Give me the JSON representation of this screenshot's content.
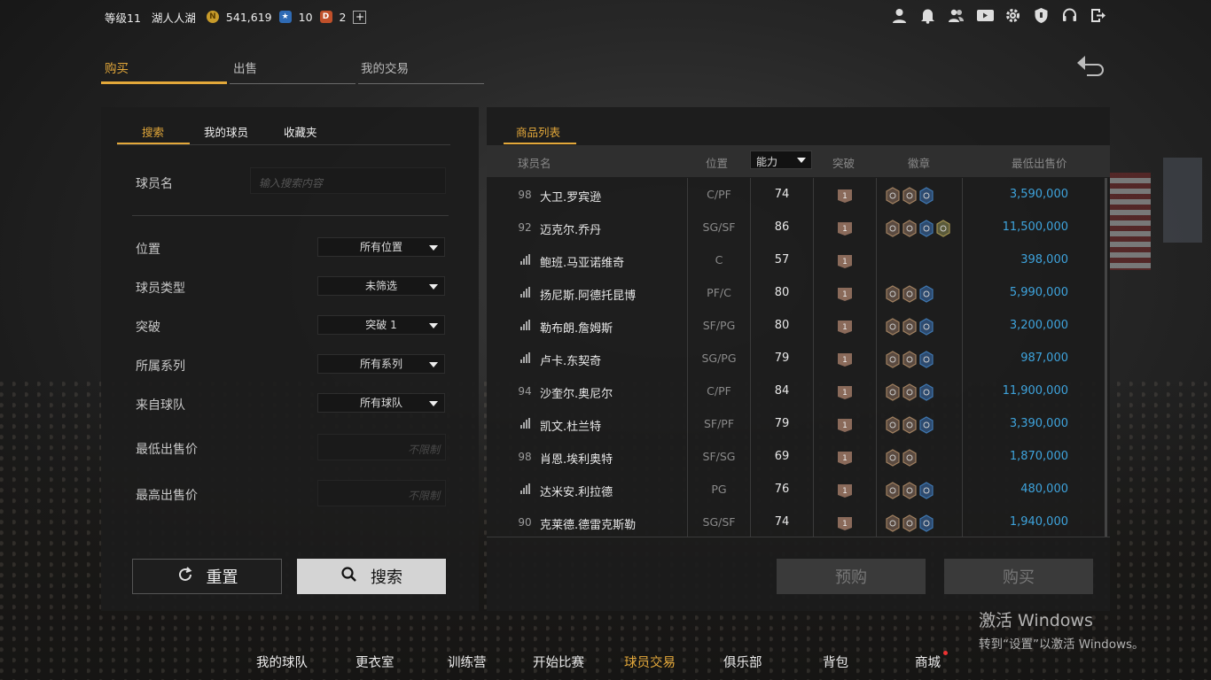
{
  "topbar": {
    "level": "等级11",
    "team_name": "湖人人湖",
    "coins": "541,619",
    "stars": "10",
    "tokens": "2"
  },
  "top_icons": [
    "person-icon",
    "bell-icon",
    "friends-icon",
    "video-icon",
    "gear-icon",
    "shield-icon",
    "headset-icon",
    "logout-icon"
  ],
  "main_tabs": [
    "购买",
    "出售",
    "我的交易"
  ],
  "left_panel": {
    "subtabs": [
      "搜索",
      "我的球员",
      "收藏夹"
    ],
    "player_name_label": "球员名",
    "search_placeholder": "输入搜索内容",
    "filters": [
      {
        "label": "位置",
        "value": "所有位置"
      },
      {
        "label": "球员类型",
        "value": "未筛选"
      },
      {
        "label": "突破",
        "value": "突破 1"
      },
      {
        "label": "所属系列",
        "value": "所有系列"
      },
      {
        "label": "来自球队",
        "value": "所有球队"
      }
    ],
    "min_price_label": "最低出售价",
    "max_price_label": "最高出售价",
    "price_placeholder": "不限制",
    "reset_label": "重置",
    "search_label": "搜索"
  },
  "right_panel": {
    "tab": "商品列表",
    "headers": {
      "name": "球员名",
      "position": "位置",
      "ability": "能力",
      "breakthrough": "突破",
      "badge": "徽章",
      "min_price": "最低出售价"
    },
    "rows": [
      {
        "rank": "98",
        "name": "大卫.罗宾逊",
        "position": "C/PF",
        "ability": "74",
        "badges": 3,
        "price": "3,590,000"
      },
      {
        "rank": "92",
        "name": "迈克尔.乔丹",
        "position": "SG/SF",
        "ability": "86",
        "badges": 4,
        "price": "11,500,000"
      },
      {
        "rank": "",
        "name": "鲍班.马亚诺维奇",
        "position": "C",
        "ability": "57",
        "badges": 0,
        "price": "398,000"
      },
      {
        "rank": "",
        "name": "扬尼斯.阿德托昆博",
        "position": "PF/C",
        "ability": "80",
        "badges": 3,
        "price": "5,990,000"
      },
      {
        "rank": "",
        "name": "勒布朗.詹姆斯",
        "position": "SF/PG",
        "ability": "80",
        "badges": 3,
        "price": "3,200,000"
      },
      {
        "rank": "",
        "name": "卢卡.东契奇",
        "position": "SG/PG",
        "ability": "79",
        "badges": 3,
        "price": "987,000"
      },
      {
        "rank": "94",
        "name": "沙奎尔.奥尼尔",
        "position": "C/PF",
        "ability": "84",
        "badges": 3,
        "price": "11,900,000"
      },
      {
        "rank": "",
        "name": "凯文.杜兰特",
        "position": "SF/PF",
        "ability": "79",
        "badges": 3,
        "price": "3,390,000"
      },
      {
        "rank": "98",
        "name": "肖恩.埃利奥特",
        "position": "SF/SG",
        "ability": "69",
        "badges": 2,
        "price": "1,870,000"
      },
      {
        "rank": "",
        "name": "达米安.利拉德",
        "position": "PG",
        "ability": "76",
        "badges": 3,
        "price": "480,000"
      },
      {
        "rank": "90",
        "name": "克莱德.德雷克斯勒",
        "position": "SG/SF",
        "ability": "74",
        "badges": 3,
        "price": "1,940,000"
      }
    ],
    "preorder_label": "预购",
    "buy_label": "购买"
  },
  "watermark": {
    "line1": "激活 Windows",
    "line2": "转到“设置”以激活 Windows。"
  },
  "bottom_nav": [
    "我的球队",
    "更衣室",
    "训练营",
    "开始比赛",
    "球员交易",
    "俱乐部",
    "背包",
    "商城"
  ],
  "colors": {
    "accent": "#e3a83a",
    "price": "#3ea3dc"
  }
}
